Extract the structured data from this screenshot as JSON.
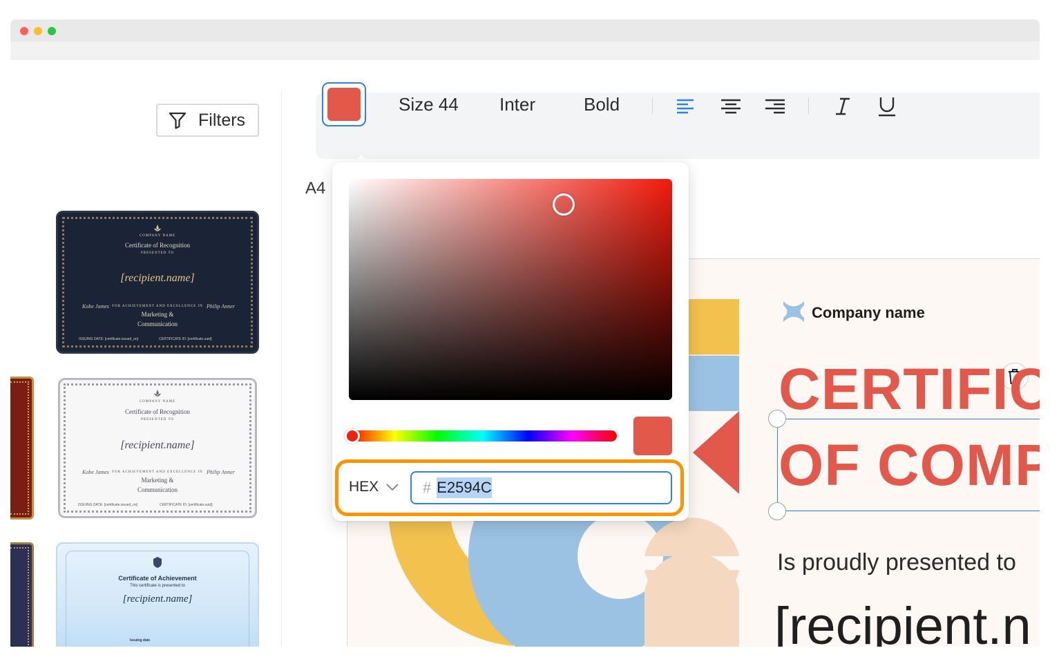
{
  "toolbar": {
    "size_label": "Size 44",
    "font_label": "Inter",
    "weight_label": "Bold",
    "text_color": "#E2594C",
    "icons": [
      "align-left-icon",
      "align-center-icon",
      "align-right-icon",
      "italic-icon",
      "underline-icon"
    ],
    "active_alignment": "left"
  },
  "sidebar": {
    "filters_label": "Filters",
    "templates": [
      {
        "company": "COMPANY NAME",
        "title": "Certificate of Recognition",
        "presented": "PRESENTED TO",
        "recipient": "[recipient.name]",
        "program_caption": "FOR ACHIEVEMENT AND EXCELLENCE IN",
        "program": "Marketing &",
        "program2": "Communication",
        "signer_left": "Kobe James",
        "signer_right": "Philip Anner",
        "issuing": "ISSUING DATE: [certificate.issued_on]",
        "cert_id": "CERTIFICATE ID: [certificate.uuid]"
      },
      {
        "company": "COMPANY NAME",
        "title": "Certificate of Recognition",
        "presented": "PRESENTED TO",
        "recipient": "[recipient.name]",
        "program_caption": "FOR ACHIEVEMENT AND EXCELLENCE IN",
        "program": "Marketing &",
        "program2": "Communication",
        "signer_left": "Kobe James",
        "signer_right": "Philip Anner",
        "issuing": "ISSUING DATE: [certificate.issued_on]",
        "cert_id": "CERTIFICATE ID: [certificate.uuid]"
      },
      {
        "title": "Certificate of Achievement",
        "presented": "This certificate is presented to",
        "recipient": "[recipient.name]",
        "issuing_label": "Issuing date"
      }
    ]
  },
  "editor": {
    "page_size_label": "A4",
    "company_name": "Company name",
    "title_line1": "CERTIFIC",
    "title_line2": "OF COMP",
    "presented_text": "Is proudly presented to",
    "recipient_text": "[recipient.n"
  },
  "color_picker": {
    "mode": "HEX",
    "hash_symbol": "#",
    "hex_value": "E2594C",
    "selected_color": "#E2594C",
    "hue_color": "#F21A0B",
    "highlight_color": "#FF9300"
  }
}
